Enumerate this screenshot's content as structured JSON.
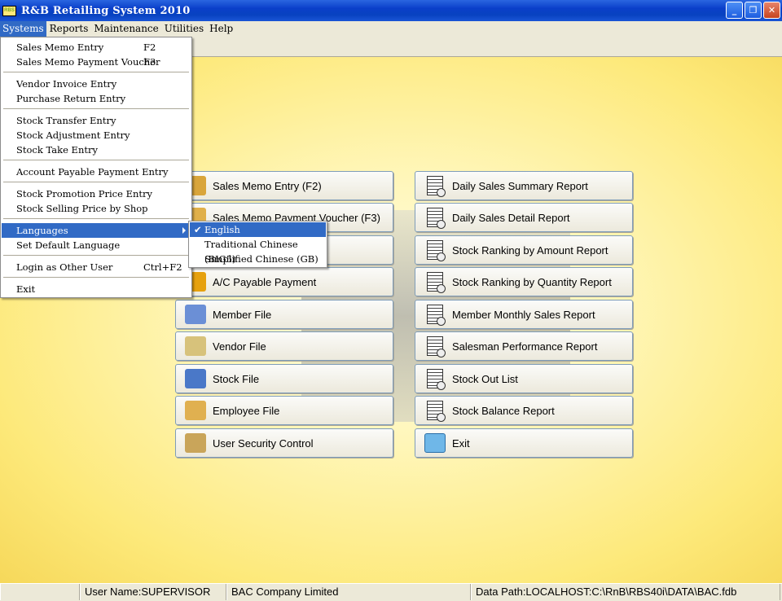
{
  "window": {
    "title": "R&B Retailing System 2010",
    "icon": "RBS",
    "minimize": "_",
    "restore": "❐",
    "close": "✕"
  },
  "menubar": [
    {
      "label": "Systems"
    },
    {
      "label": "Reports"
    },
    {
      "label": "Maintenance"
    },
    {
      "label": "Utilities"
    },
    {
      "label": "Help"
    }
  ],
  "systems_menu": [
    {
      "label": "Sales Memo Entry",
      "shortcut": "F2"
    },
    {
      "label": "Sales Memo Payment Voucher",
      "shortcut": "F3"
    },
    {
      "label": "Vendor Invoice Entry",
      "shortcut": ""
    },
    {
      "label": "Purchase Return Entry",
      "shortcut": ""
    },
    {
      "label": "Stock Transfer Entry",
      "shortcut": ""
    },
    {
      "label": "Stock Adjustment Entry",
      "shortcut": ""
    },
    {
      "label": "Stock Take Entry",
      "shortcut": ""
    },
    {
      "label": "Account Payable Payment Entry",
      "shortcut": ""
    },
    {
      "label": "Stock Promotion Price Entry",
      "shortcut": ""
    },
    {
      "label": "Stock Selling Price by Shop",
      "shortcut": ""
    },
    {
      "label": "Languages",
      "shortcut": ""
    },
    {
      "label": "Set Default Language",
      "shortcut": ""
    },
    {
      "label": "Login as Other User",
      "shortcut": "Ctrl+F2"
    },
    {
      "label": "Exit",
      "shortcut": ""
    }
  ],
  "languages_menu": [
    {
      "label": "English",
      "checked": "✔"
    },
    {
      "label": "Traditional Chinese (BIG5)"
    },
    {
      "label": "Simplified Chinese (GB)"
    }
  ],
  "left_buttons": [
    {
      "label": "Sales Memo Entry (F2)",
      "icon": "sales-memo-icon",
      "color": "#d9a53b"
    },
    {
      "label": "Sales Memo Payment Voucher (F3)",
      "icon": "payment-voucher-icon",
      "color": "#e0b04a"
    },
    {
      "label": "",
      "icon": "hidden-icon",
      "color": "#c9a030"
    },
    {
      "label": "A/C Payable Payment",
      "icon": "payable-payment-icon",
      "color": "#e6a10e"
    },
    {
      "label": "Member File",
      "icon": "member-file-icon",
      "color": "#6b8fd6"
    },
    {
      "label": "Vendor File",
      "icon": "vendor-file-icon",
      "color": "#d7c27b"
    },
    {
      "label": "Stock File",
      "icon": "stock-file-icon",
      "color": "#4a78c8"
    },
    {
      "label": "Employee File",
      "icon": "employee-file-icon",
      "color": "#e0b050"
    },
    {
      "label": "User Security Control",
      "icon": "security-icon",
      "color": "#c9a55a"
    }
  ],
  "right_buttons": [
    {
      "label": "Daily Sales Summary Report",
      "icon": "report-icon"
    },
    {
      "label": "Daily Sales Detail Report",
      "icon": "report-icon"
    },
    {
      "label": "Stock Ranking by Amount Report",
      "icon": "report-icon"
    },
    {
      "label": "Stock Ranking by Quantity Report",
      "icon": "report-icon"
    },
    {
      "label": "Member Monthly Sales Report",
      "icon": "report-icon"
    },
    {
      "label": "Salesman Performance Report",
      "icon": "report-icon"
    },
    {
      "label": "Stock Out List",
      "icon": "report-icon"
    },
    {
      "label": "Stock Balance Report",
      "icon": "report-icon"
    },
    {
      "label": "Exit",
      "icon": "exit-door-icon"
    }
  ],
  "statusbar": {
    "user": "User Name:SUPERVISOR",
    "company": "BAC Company Limited",
    "data_path": "Data Path:LOCALHOST:C:\\RnB\\RBS40i\\DATA\\BAC.fdb"
  }
}
